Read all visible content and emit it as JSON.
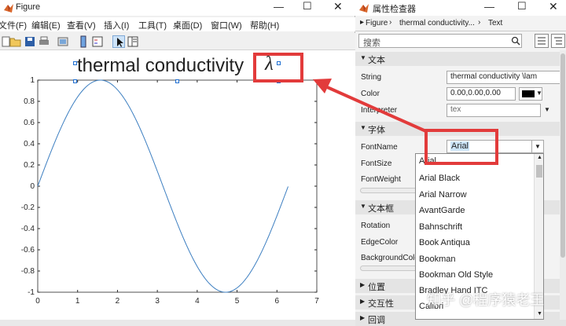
{
  "figure_window": {
    "title": "Figure",
    "menu": [
      "文件(F)",
      "编辑(E)",
      "查看(V)",
      "插入(I)",
      "工具(T)",
      "桌面(D)",
      "窗口(W)",
      "帮助(H)"
    ]
  },
  "plot": {
    "title_text": "thermal conductivity",
    "title_symbol": "λ"
  },
  "chart_data": {
    "type": "line",
    "title": "thermal conductivity λ",
    "xlabel": "",
    "ylabel": "",
    "xlim": [
      0,
      7
    ],
    "ylim": [
      -1,
      1
    ],
    "x_ticks": [
      0,
      1,
      2,
      3,
      4,
      5,
      6,
      7
    ],
    "y_ticks": [
      -1,
      -0.8,
      -0.6,
      -0.4,
      -0.2,
      0,
      0.2,
      0.4,
      0.6,
      0.8,
      1
    ],
    "x_tick_labels": [
      "0",
      "1",
      "2",
      "3",
      "4",
      "5",
      "6",
      "7"
    ],
    "y_tick_labels": [
      "-1",
      "-0.8",
      "-0.6",
      "-0.4",
      "-0.2",
      "0",
      "0.2",
      "0.4",
      "0.6",
      "0.8",
      "1"
    ],
    "series": [
      {
        "function": "sin(x)",
        "x_range": [
          0,
          6.28
        ],
        "color": "#3d7fc1"
      }
    ],
    "grid": false
  },
  "inspector": {
    "title": "属性检查器",
    "breadcrumb": [
      "Figure",
      "thermal conductivity...",
      "Text"
    ],
    "search_placeholder": "搜索",
    "sections": {
      "text": "文本",
      "font": "字体",
      "textbox": "文本框",
      "position": "位置",
      "interactivity": "交互性",
      "callbacks": "回调"
    },
    "props": {
      "string_label": "String",
      "string_value": "thermal conductivity \\lam",
      "color_label": "Color",
      "color_value": "0.00,0.00,0.00",
      "interpreter_label": "Interpreter",
      "interpreter_value": "tex",
      "fontname_label": "FontName",
      "fontname_value": "Arial",
      "fontsize_label": "FontSize",
      "fontweight_label": "FontWeight",
      "rotation_label": "Rotation",
      "edgecolor_label": "EdgeColor",
      "backgroundcolor_label": "BackgroundColo"
    },
    "font_options": [
      "Arial",
      "Arial Black",
      "Arial Narrow",
      "AvantGarde",
      "Bahnschrift",
      "Book Antiqua",
      "Bookman",
      "Bookman Old Style",
      "Bradley Hand ITC",
      "Calibri"
    ]
  },
  "watermark": "知乎 @程序猿老王",
  "colors": {
    "accent_red": "#e23b3b",
    "plot_line": "#3d7fc1",
    "selection_blue": "#cce4f7"
  }
}
